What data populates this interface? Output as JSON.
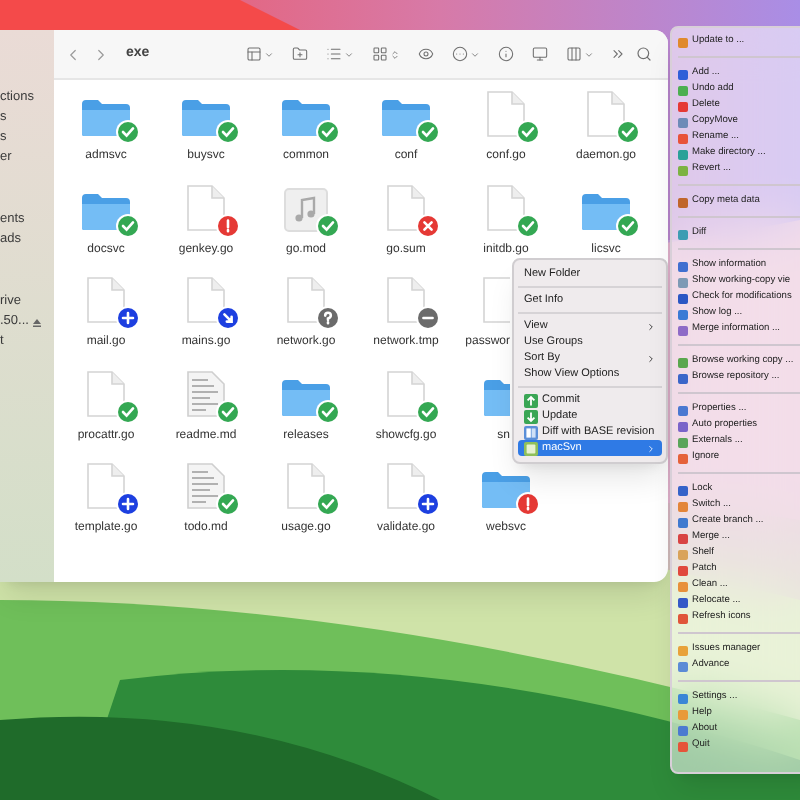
{
  "sidebar": {
    "sections": [
      {
        "items": [
          {
            "label": "ctions"
          },
          {
            "label": "s"
          },
          {
            "label": "s"
          },
          {
            "label": "er"
          }
        ]
      },
      {
        "items": [
          {
            "label": "ents"
          },
          {
            "label": "ads"
          }
        ]
      },
      {
        "items": [
          {
            "label": "rive"
          },
          {
            "label": ".50...",
            "eject": true
          },
          {
            "label": "t"
          }
        ]
      }
    ]
  },
  "toolbar": {
    "title": "exe"
  },
  "rows": [
    [
      {
        "name": "admsvc",
        "kind": "folder",
        "badge": {
          "kind": "check",
          "color": "#34a853"
        }
      },
      {
        "name": "buysvc",
        "kind": "folder",
        "badge": {
          "kind": "check",
          "color": "#34a853"
        }
      },
      {
        "name": "common",
        "kind": "folder",
        "badge": {
          "kind": "check",
          "color": "#34a853"
        }
      },
      {
        "name": "conf",
        "kind": "folder",
        "badge": {
          "kind": "check",
          "color": "#34a853"
        }
      },
      {
        "name": "conf.go",
        "kind": "file",
        "badge": {
          "kind": "check",
          "color": "#34a853"
        }
      },
      {
        "name": "daemon.go",
        "kind": "file",
        "badge": {
          "kind": "check",
          "color": "#34a853"
        }
      }
    ],
    [
      {
        "name": "docsvc",
        "kind": "folder",
        "badge": {
          "kind": "check",
          "color": "#34a853"
        }
      },
      {
        "name": "genkey.go",
        "kind": "file",
        "badge": {
          "kind": "exclamation",
          "color": "#e53935"
        }
      },
      {
        "name": "go.mod",
        "kind": "audio",
        "badge": {
          "kind": "check",
          "color": "#34a853"
        }
      },
      {
        "name": "go.sum",
        "kind": "file",
        "badge": {
          "kind": "cross",
          "color": "#e53935"
        }
      },
      {
        "name": "initdb.go",
        "kind": "file",
        "badge": {
          "kind": "check",
          "color": "#34a853"
        }
      },
      {
        "name": "licsvc",
        "kind": "folder",
        "badge": {
          "kind": "check",
          "color": "#34a853"
        }
      }
    ],
    [
      {
        "name": "mail.go",
        "kind": "file",
        "badge": {
          "kind": "plus",
          "color": "#1d3fe0"
        }
      },
      {
        "name": "mains.go",
        "kind": "file",
        "badge": {
          "kind": "arrow",
          "color": "#1d3fe0"
        }
      },
      {
        "name": "network.go",
        "kind": "file",
        "badge": {
          "kind": "question",
          "color": "#6b6b6b"
        }
      },
      {
        "name": "network.tmp",
        "kind": "file",
        "badge": {
          "kind": "minus",
          "color": "#6b6b6b"
        }
      },
      {
        "name": "passwor",
        "kind": "file",
        "covered": true
      }
    ],
    [
      {
        "name": "procattr.go",
        "kind": "file",
        "badge": {
          "kind": "check",
          "color": "#34a853"
        }
      },
      {
        "name": "readme.md",
        "kind": "text",
        "badge": {
          "kind": "check",
          "color": "#34a853"
        }
      },
      {
        "name": "releases",
        "kind": "folder",
        "badge": {
          "kind": "check",
          "color": "#34a853"
        }
      },
      {
        "name": "showcfg.go",
        "kind": "file",
        "badge": {
          "kind": "check",
          "color": "#34a853"
        }
      },
      {
        "name": "sn",
        "kind": "folder",
        "covered": true
      }
    ],
    [
      {
        "name": "template.go",
        "kind": "file",
        "badge": {
          "kind": "plus",
          "color": "#1d3fe0"
        }
      },
      {
        "name": "todo.md",
        "kind": "text",
        "badge": {
          "kind": "check",
          "color": "#34a853"
        }
      },
      {
        "name": "usage.go",
        "kind": "file",
        "badge": {
          "kind": "check",
          "color": "#34a853"
        }
      },
      {
        "name": "validate.go",
        "kind": "file",
        "badge": {
          "kind": "plus",
          "color": "#1d3fe0"
        }
      },
      {
        "name": "websvc",
        "kind": "folder",
        "badge": {
          "kind": "exclamation",
          "color": "#e53935"
        }
      }
    ]
  ],
  "context_menu": {
    "groups": [
      [
        {
          "label": "New Folder",
          "kind": "plain",
          "submenu": false,
          "selected": false
        }
      ],
      [
        {
          "label": "Get Info",
          "kind": "plain",
          "submenu": false,
          "selected": false
        }
      ],
      [
        {
          "label": "View",
          "kind": "plain",
          "submenu": true,
          "selected": false
        },
        {
          "label": "Use Groups",
          "kind": "plain",
          "submenu": false,
          "selected": false
        },
        {
          "label": "Sort By",
          "kind": "plain",
          "submenu": true,
          "selected": false
        },
        {
          "label": "Show View Options",
          "kind": "plain",
          "submenu": false,
          "selected": false
        }
      ],
      [
        {
          "label": "Commit",
          "kind": "commit",
          "submenu": false,
          "selected": false
        },
        {
          "label": "Update",
          "kind": "update",
          "submenu": false,
          "selected": false
        },
        {
          "label": "Diff with BASE revision",
          "kind": "diff",
          "submenu": false,
          "selected": false
        },
        {
          "label": "macSvn",
          "kind": "app",
          "submenu": true,
          "selected": true
        }
      ]
    ]
  },
  "svn_menu": {
    "groups": [
      [
        {
          "label": "Update to ...",
          "color": "#e08a2c"
        }
      ],
      [
        {
          "label": "Add ...",
          "color": "#2f5fd8"
        },
        {
          "label": "Undo add",
          "color": "#4caf50"
        },
        {
          "label": "Delete",
          "color": "#e53935"
        },
        {
          "label": "CopyMove",
          "color": "#6d8bb8"
        },
        {
          "label": "Rename ...",
          "color": "#e8533a"
        },
        {
          "label": "Make directory ...",
          "color": "#2aa198"
        },
        {
          "label": "Revert ...",
          "color": "#7cb342"
        }
      ],
      [
        {
          "label": "Copy meta data",
          "color": "#c0662b"
        }
      ],
      [
        {
          "label": "Diff",
          "color": "#3d9db3"
        }
      ],
      [
        {
          "label": "Show information",
          "color": "#3f6fd0"
        },
        {
          "label": "Show working-copy vie",
          "color": "#7d9ab5"
        },
        {
          "label": "Check for modifications",
          "color": "#2b57c4"
        },
        {
          "label": "Show log ...",
          "color": "#3a7bd5"
        },
        {
          "label": "Merge information ...",
          "color": "#8e6bc7"
        }
      ],
      [
        {
          "label": "Browse working copy ...",
          "color": "#5aa74e"
        },
        {
          "label": "Browse repository ...",
          "color": "#3b66c9"
        }
      ],
      [
        {
          "label": "Properties ...",
          "color": "#4a78d1"
        },
        {
          "label": "Auto properties",
          "color": "#7a64c9"
        },
        {
          "label": "Externals ...",
          "color": "#5aa55a"
        },
        {
          "label": "Ignore",
          "color": "#e5623a"
        }
      ],
      [
        {
          "label": "Lock",
          "color": "#3563c9"
        },
        {
          "label": "Switch ...",
          "color": "#e3853a"
        },
        {
          "label": "Create branch ...",
          "color": "#3f79cf"
        },
        {
          "label": "Merge ...",
          "color": "#d84343"
        },
        {
          "label": "Shelf",
          "color": "#d9a35a"
        },
        {
          "label": "Patch",
          "color": "#e0483d"
        },
        {
          "label": "Clean ...",
          "color": "#e8903b"
        },
        {
          "label": "Relocate ...",
          "color": "#3558c7"
        },
        {
          "label": "Refresh icons",
          "color": "#e0553a"
        }
      ],
      [
        {
          "label": "Issues manager",
          "color": "#e8a23a"
        },
        {
          "label": "Advance",
          "color": "#5b8bd6"
        }
      ],
      [
        {
          "label": "Settings ...",
          "color": "#3a86d6"
        },
        {
          "label": "Help",
          "color": "#e89a3a"
        },
        {
          "label": "About",
          "color": "#4b7ad0"
        },
        {
          "label": "Quit",
          "color": "#e5543a"
        }
      ]
    ]
  }
}
